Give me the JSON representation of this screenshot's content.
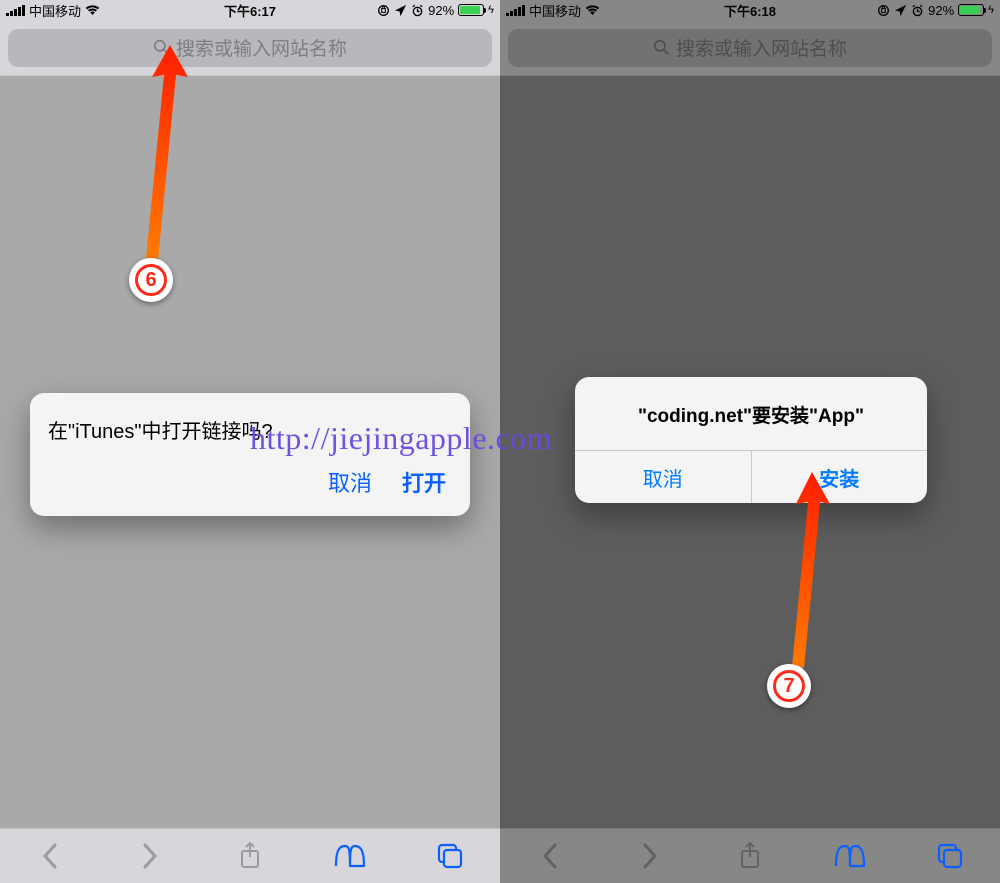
{
  "left": {
    "status": {
      "carrier": "中国移动",
      "time": "下午6:17",
      "battery_pct": "92%"
    },
    "search_placeholder": "搜索或输入网站名称",
    "alert": {
      "message": "在\"iTunes\"中打开链接吗?",
      "cancel": "取消",
      "confirm": "打开"
    },
    "annotation_number": "6"
  },
  "right": {
    "status": {
      "carrier": "中国移动",
      "time": "下午6:18",
      "battery_pct": "92%"
    },
    "search_placeholder": "搜索或输入网站名称",
    "alert": {
      "message": "\"coding.net\"要安装\"App\"",
      "cancel": "取消",
      "confirm": "安装"
    },
    "annotation_number": "7"
  },
  "watermark_url": "http://jiejingapple.com",
  "colors": {
    "ios_blue": "#007aff",
    "annotation_red": "#ff2a1a",
    "battery_green": "#39d054"
  }
}
